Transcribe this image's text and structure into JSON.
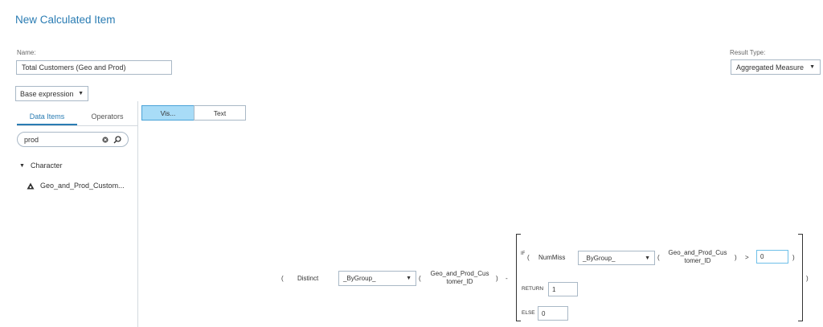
{
  "window": {
    "title": "New Calculated Item"
  },
  "name_field": {
    "label": "Name:",
    "value": "Total Customers (Geo and Prod)"
  },
  "result_type": {
    "label": "Result Type:",
    "value": "Aggregated Measure"
  },
  "base_expression": {
    "value": "Base expression"
  },
  "left_tabs": {
    "data_items": "Data Items",
    "operators": "Operators"
  },
  "search": {
    "value": "prod"
  },
  "tree": {
    "group_label": "Character",
    "item_label": "Geo_and_Prod_Custom..."
  },
  "editor_toggle": {
    "visual": "Vis...",
    "text": "Text"
  },
  "expression": {
    "open_paren_1": "(",
    "distinct": "Distinct",
    "bygroup_1": "_ByGroup_",
    "open_paren_2": "(",
    "field_1_line1": "Geo_and_Prod_Cus",
    "field_1_line2": "tomer_ID",
    "close_paren_1": ")",
    "minus": "-",
    "if": "IF",
    "if_paren": "(",
    "nummiss": "NumMiss",
    "bygroup_2": "_ByGroup_",
    "open_paren_3": "(",
    "field_2_line1": "Geo_and_Prod_Cus",
    "field_2_line2": "tomer_ID",
    "close_paren_2": ")",
    "gt": ">",
    "compare_value": "0",
    "close_paren_3": ")",
    "return_label": "RETURN",
    "return_value": "1",
    "else_label": "ELSE",
    "else_value": "0",
    "close_paren_outer": ")"
  },
  "colors": {
    "accent": "#2a7cb3",
    "toggle_active": "#a8dcf7",
    "border": "#a9b8c6"
  }
}
